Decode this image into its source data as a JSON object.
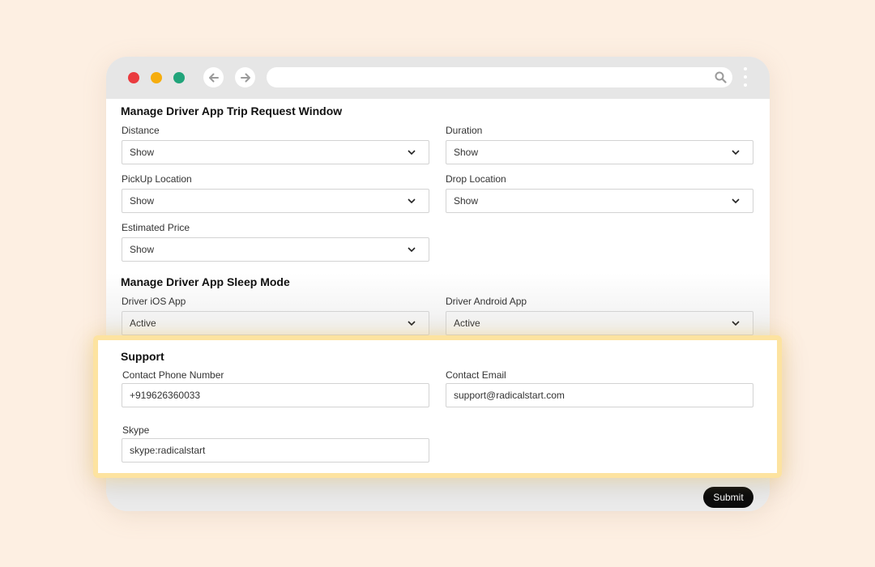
{
  "trip_window": {
    "title": "Manage Driver App Trip Request Window",
    "distance": {
      "label": "Distance",
      "value": "Show"
    },
    "duration": {
      "label": "Duration",
      "value": "Show"
    },
    "pickup": {
      "label": "PickUp Location",
      "value": "Show"
    },
    "drop": {
      "label": "Drop Location",
      "value": "Show"
    },
    "estimated_price": {
      "label": "Estimated Price",
      "value": "Show"
    }
  },
  "sleep_mode": {
    "title": "Manage Driver App Sleep Mode",
    "ios": {
      "label": "Driver iOS App",
      "value": "Active"
    },
    "android": {
      "label": "Driver Android App",
      "value": "Active"
    }
  },
  "support": {
    "title": "Support",
    "phone": {
      "label": "Contact Phone Number",
      "value": "+919626360033"
    },
    "email": {
      "label": "Contact Email",
      "value": "support@radicalstart.com"
    },
    "skype": {
      "label": "Skype",
      "value": "skype:radicalstart"
    }
  },
  "submit_label": "Submit",
  "colors": {
    "background": "#fdefe2",
    "highlight_border": "#fde3a0",
    "dot_red": "#ea3b3f",
    "dot_yellow": "#f6ad0d",
    "dot_green": "#21a47a",
    "submit_bg": "#0d0d0d"
  },
  "icons": [
    "back-arrow-icon",
    "forward-arrow-icon",
    "search-icon",
    "kebab-menu-icon",
    "chevron-down-icon"
  ]
}
